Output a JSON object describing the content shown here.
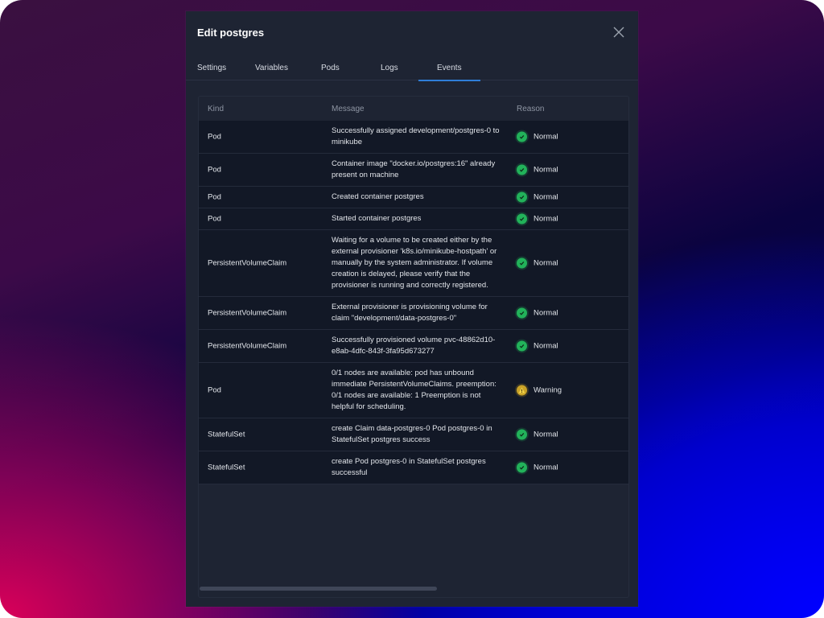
{
  "modal": {
    "title": "Edit postgres",
    "close_label": "close"
  },
  "tabs": [
    {
      "label": "Settings",
      "active": false
    },
    {
      "label": "Variables",
      "active": false
    },
    {
      "label": "Pods",
      "active": false
    },
    {
      "label": "Logs",
      "active": false
    },
    {
      "label": "Events",
      "active": true
    }
  ],
  "table": {
    "columns": [
      "Kind",
      "Message",
      "Reason"
    ],
    "rows": [
      {
        "kind": "Pod",
        "message": "Successfully assigned development/postgres-0 to minikube",
        "reason": "Normal",
        "status": "ok"
      },
      {
        "kind": "Pod",
        "message": "Container image \"docker.io/postgres:16\" already present on machine",
        "reason": "Normal",
        "status": "ok"
      },
      {
        "kind": "Pod",
        "message": "Created container postgres",
        "reason": "Normal",
        "status": "ok"
      },
      {
        "kind": "Pod",
        "message": "Started container postgres",
        "reason": "Normal",
        "status": "ok"
      },
      {
        "kind": "PersistentVolumeClaim",
        "message": "Waiting for a volume to be created either by the external provisioner 'k8s.io/minikube-hostpath' or manually by the system administrator. If volume creation is delayed, please verify that the provisioner is running and correctly registered.",
        "reason": "Normal",
        "status": "ok"
      },
      {
        "kind": "PersistentVolumeClaim",
        "message": "External provisioner is provisioning volume for claim \"development/data-postgres-0\"",
        "reason": "Normal",
        "status": "ok"
      },
      {
        "kind": "PersistentVolumeClaim",
        "message": "Successfully provisioned volume pvc-48862d10-e8ab-4dfc-843f-3fa95d673277",
        "reason": "Normal",
        "status": "ok"
      },
      {
        "kind": "Pod",
        "message": "0/1 nodes are available: pod has unbound immediate PersistentVolumeClaims. preemption: 0/1 nodes are available: 1 Preemption is not helpful for scheduling.",
        "reason": "Warning",
        "status": "warn"
      },
      {
        "kind": "StatefulSet",
        "message": "create Claim data-postgres-0 Pod postgres-0 in StatefulSet postgres success",
        "reason": "Normal",
        "status": "ok"
      },
      {
        "kind": "StatefulSet",
        "message": "create Pod postgres-0 in StatefulSet postgres successful",
        "reason": "Normal",
        "status": "ok"
      }
    ]
  },
  "icons": {
    "ok": "check-circle-icon",
    "warn": "warning-triangle-icon",
    "close": "close-x-icon"
  },
  "colors": {
    "accent": "#2f7ed8",
    "ok": "#22b25a",
    "warn": "#c9a227",
    "modal_bg": "#1e2433",
    "row_bg": "#121826"
  },
  "scroll": {
    "horizontal_visible_fraction": 0.55
  }
}
